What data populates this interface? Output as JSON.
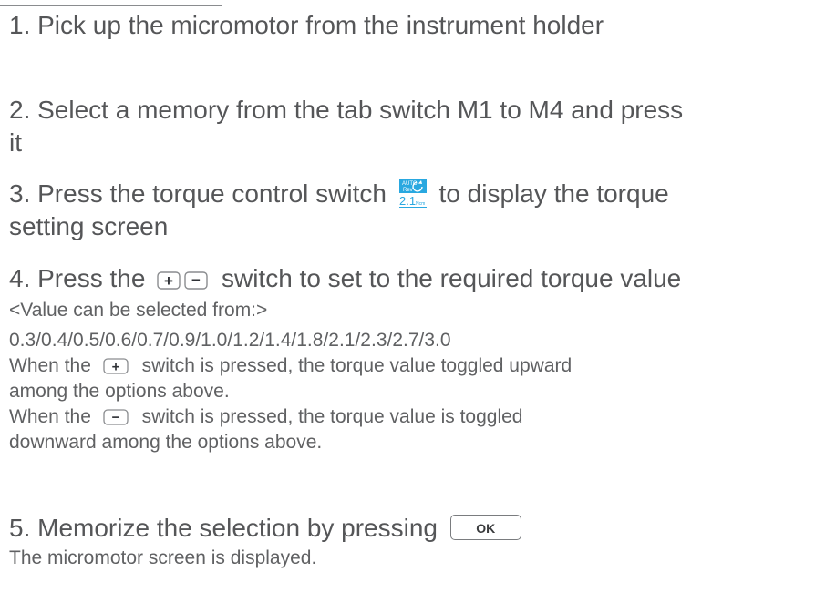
{
  "steps": {
    "s1": "1. Pick up the micromotor from the instrument holder",
    "s2_line1": "2. Select a memory from the tab switch M1 to M4 and press",
    "s2_line2": "it",
    "s3_before": "3. Press the torque control switch",
    "s3_after": "to display the torque",
    "s3_line2": "setting screen",
    "s4_before": "4. Press the",
    "s4_after": "switch to set to the required torque value",
    "s5_before": "5. Memorize the selection by pressing"
  },
  "notes": {
    "values_heading": "<Value can be selected from:>",
    "values_list": "0.3/0.4/0.5/0.6/0.7/0.9/1.0/1.2/1.4/1.8/2.1/2.3/2.7/3.0",
    "plus_before": "When the",
    "plus_after": "switch is pressed, the torque value toggled upward",
    "plus_line2": "among the options above.",
    "minus_before": "When the",
    "minus_after": "switch is pressed, the torque value is toggled",
    "minus_line2": "downward among the options above.",
    "result": "The micromotor screen is displayed."
  },
  "torque_switch": {
    "auto_label": "AUTO",
    "rev_label": "Rev",
    "value": "2.1",
    "unit": "Ncm",
    "icon": "rotation-arrow-icon"
  },
  "buttons": {
    "plus_glyph": "+",
    "minus_glyph": "−",
    "ok_label": "OK"
  },
  "colors": {
    "text": "#555658",
    "torque_accent": "#29a8e0"
  }
}
